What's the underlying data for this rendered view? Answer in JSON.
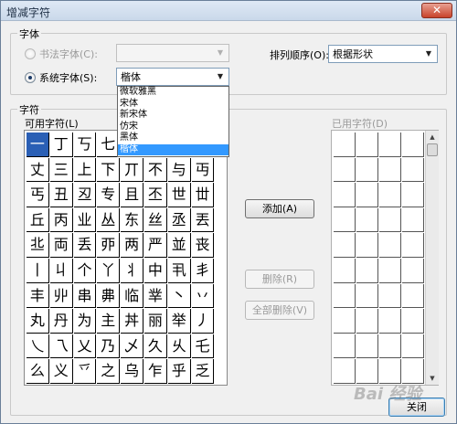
{
  "window": {
    "title": "增减字符",
    "close_glyph": "✕"
  },
  "font_group": {
    "legend": "字体",
    "calligraphy_radio": "书法字体(C):",
    "system_radio": "系统字体(S):",
    "system_font_value": "楷体",
    "calligraphy_font_value": "",
    "sort_label": "排列顺序(O):",
    "sort_value": "根据形状"
  },
  "font_dropdown": {
    "options": [
      "微软雅黑",
      "宋体",
      "新宋体",
      "仿宋",
      "黑体",
      "楷体"
    ],
    "selected": "楷体"
  },
  "char_group": {
    "legend": "字符",
    "available_label": "可用字符(L)",
    "used_label": "已用字符(D)"
  },
  "available_chars": [
    [
      "一",
      "丁",
      "丂",
      "七",
      "",
      "",
      "",
      ""
    ],
    [
      "丈",
      "三",
      "上",
      "下",
      "丌",
      "不",
      "与",
      "丏"
    ],
    [
      "丐",
      "丑",
      "丒",
      "专",
      "且",
      "丕",
      "世",
      "丗"
    ],
    [
      "丘",
      "丙",
      "业",
      "丛",
      "东",
      "丝",
      "丞",
      "丟"
    ],
    [
      "丠",
      "両",
      "丢",
      "丣",
      "两",
      "严",
      "並",
      "丧"
    ],
    [
      "丨",
      "丩",
      "个",
      "丫",
      "丬",
      "中",
      "丮",
      "丯"
    ],
    [
      "丰",
      "丱",
      "串",
      "丳",
      "临",
      "丵",
      "丶",
      "丷"
    ],
    [
      "丸",
      "丹",
      "为",
      "主",
      "丼",
      "丽",
      "举",
      "丿"
    ],
    [
      "乀",
      "乁",
      "乂",
      "乃",
      "乄",
      "久",
      "乆",
      "乇"
    ],
    [
      "么",
      "义",
      "乊",
      "之",
      "乌",
      "乍",
      "乎",
      "乏"
    ]
  ],
  "buttons": {
    "add": "添加(A)",
    "delete": "删除(R)",
    "delete_all": "全部删除(V)",
    "close": "关闭"
  },
  "watermark": "Bai 经验"
}
